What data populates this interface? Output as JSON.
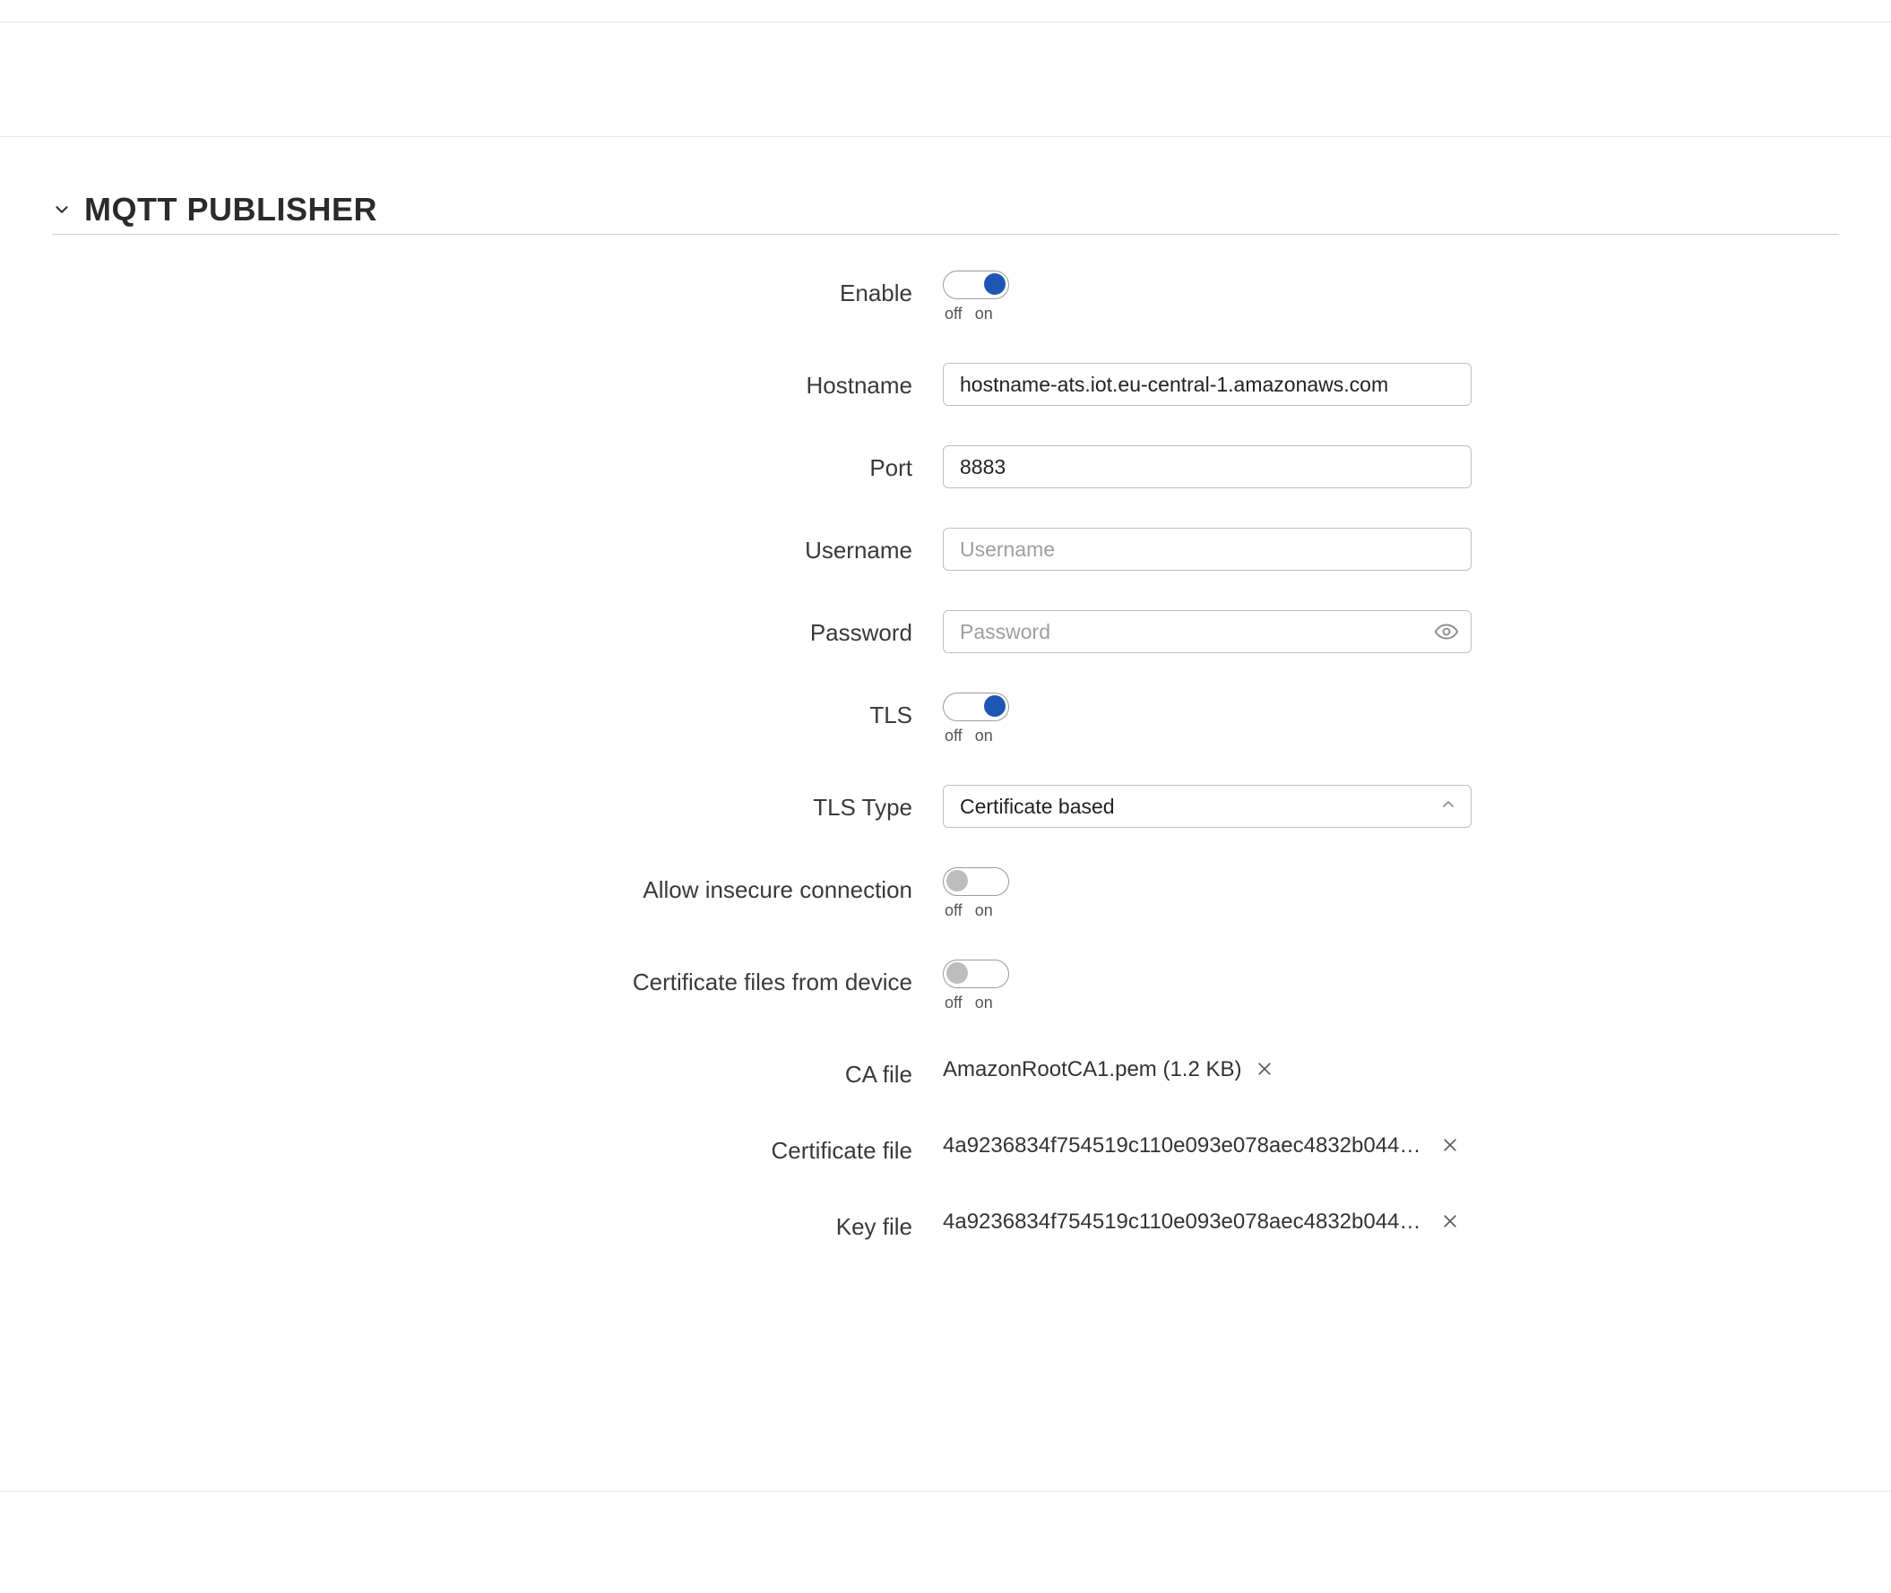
{
  "section": {
    "title": "MQTT PUBLISHER"
  },
  "toggle_sub": {
    "off": "off",
    "on": "on"
  },
  "fields": {
    "enable": {
      "label": "Enable",
      "state": "on"
    },
    "hostname": {
      "label": "Hostname",
      "value": "hostname-ats.iot.eu-central-1.amazonaws.com"
    },
    "port": {
      "label": "Port",
      "value": "8883"
    },
    "username": {
      "label": "Username",
      "value": "",
      "placeholder": "Username"
    },
    "password": {
      "label": "Password",
      "value": "",
      "placeholder": "Password"
    },
    "tls": {
      "label": "TLS",
      "state": "on"
    },
    "tls_type": {
      "label": "TLS Type",
      "value": "Certificate based"
    },
    "allow_insecure": {
      "label": "Allow insecure connection",
      "state": "off"
    },
    "cert_from_device": {
      "label": "Certificate files from device",
      "state": "off"
    },
    "ca_file": {
      "label": "CA file",
      "value": "AmazonRootCA1.pem (1.2 KB)"
    },
    "cert_file": {
      "label": "Certificate file",
      "value": "4a9236834f754519c110e093e078aec4832b0444…"
    },
    "key_file": {
      "label": "Key file",
      "value": "4a9236834f754519c110e093e078aec4832b0444…"
    }
  }
}
